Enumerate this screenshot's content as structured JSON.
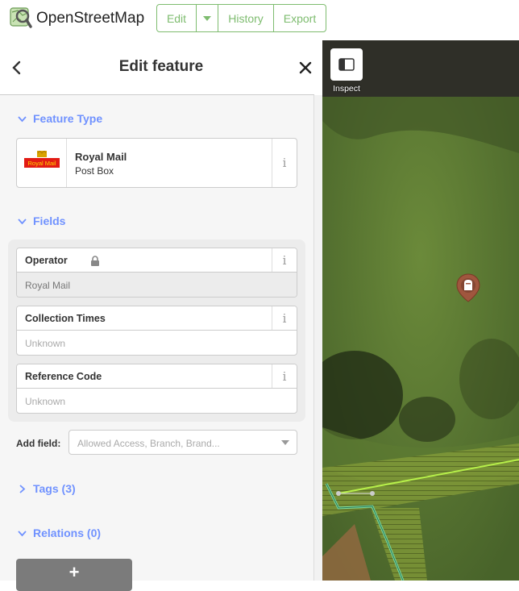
{
  "app": {
    "name": "OpenStreetMap",
    "toolbar": {
      "edit": "Edit",
      "history": "History",
      "export": "Export"
    }
  },
  "sidebar": {
    "title": "Edit feature",
    "feature_type": {
      "heading": "Feature Type",
      "preset_name": "Royal Mail",
      "preset_type": "Post Box",
      "logo_text": "Royal Mail"
    },
    "fields": {
      "heading": "Fields",
      "items": [
        {
          "label": "Operator",
          "value": "Royal Mail",
          "locked": true
        },
        {
          "label": "Collection Times",
          "placeholder": "Unknown"
        },
        {
          "label": "Reference Code",
          "placeholder": "Unknown"
        }
      ],
      "add_field_label": "Add field:",
      "add_field_placeholder": "Allowed Access, Branch, Brand..."
    },
    "tags": {
      "heading": "Tags (3)"
    },
    "relations": {
      "heading": "Relations (0)",
      "add_label": "+"
    }
  },
  "map": {
    "inspect_label": "Inspect"
  },
  "colors": {
    "accent_green": "#7ebc6f",
    "section_blue": "#7092ff",
    "pin_color": "#a0563e"
  }
}
